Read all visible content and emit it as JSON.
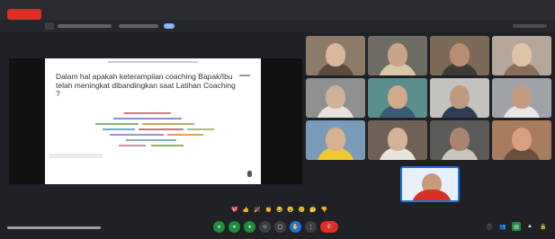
{
  "top": {
    "rec_label": "Recording",
    "url": "meet.google.com/xxx-xxxx-xxx"
  },
  "slide": {
    "question": "Dalam hal apakah keterampilan coaching Bapak/Ibu telah meningkat dibandingkan saat Latihan Coaching ?"
  },
  "tiles": [
    {
      "tone": "#8d7b6a",
      "face": "#d9b89b",
      "body": "#5b4a3e"
    },
    {
      "tone": "#6f6c64",
      "face": "#caa488",
      "body": "#d9c7a8"
    },
    {
      "tone": "#7c6a59",
      "face": "#b88e70",
      "body": "#3e3a36"
    },
    {
      "tone": "#b6a79a",
      "face": "#e0c2a6",
      "body": "#8a6e5a"
    },
    {
      "tone": "#8f8f8f",
      "face": "#d0b098",
      "body": "#e6e2dc"
    },
    {
      "tone": "#5a8e8c",
      "face": "#d2a98a",
      "body": "#3b5b74"
    },
    {
      "tone": "#c4c2bf",
      "face": "#bf9a80",
      "body": "#2f3d56"
    },
    {
      "tone": "#9fa3a8",
      "face": "#c49b7e",
      "body": "#e6e6e6"
    },
    {
      "tone": "#7a9bb8",
      "face": "#d8b190",
      "body": "#f0c830"
    },
    {
      "tone": "#6f6156",
      "face": "#d4b296",
      "body": "#e9e4dd"
    },
    {
      "tone": "#5c5a58",
      "face": "#a98470",
      "body": "#c9c4bd"
    },
    {
      "tone": "#a77c5f",
      "face": "#d9a07e",
      "body": "#6b4f3b"
    }
  ],
  "reactions": [
    "💖",
    "👍",
    "🎉",
    "👏",
    "😂",
    "😮",
    "😢",
    "🤔",
    "👎"
  ],
  "controls": [
    "mic",
    "cam",
    "caption",
    "emoji",
    "present",
    "raise",
    "more"
  ],
  "colors": {
    "accent_blue": "#1a73e8",
    "end_red": "#d93025",
    "active_green": "#1e8e3e"
  }
}
